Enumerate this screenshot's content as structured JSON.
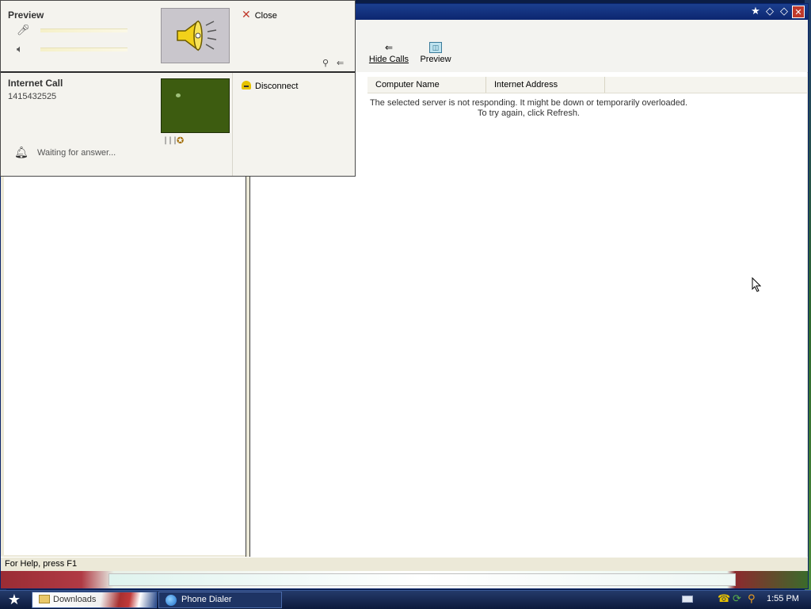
{
  "window": {
    "controls": [
      "★",
      "◇",
      "◇",
      "✕"
    ]
  },
  "toolbar": {
    "hide_calls": {
      "label": "Hide Calls",
      "icon": "arrow-left-icon"
    },
    "preview": {
      "label": "Preview",
      "icon": "preview-icon"
    }
  },
  "list": {
    "columns": [
      "Computer Name",
      "Internet Address"
    ],
    "message_line1": "The selected server is not responding. It might be down or temporarily overloaded.",
    "message_line2": "To try again, click Refresh."
  },
  "statusbar": {
    "text": "For Help, press F1"
  },
  "call_panel": {
    "preview": {
      "title": "Preview",
      "close_label": "Close",
      "mic_level": 0,
      "speaker_level": 0
    },
    "call": {
      "title": "Internet Call",
      "number": "1415432525",
      "status": "Waiting for answer...",
      "disconnect_label": "Disconnect"
    }
  },
  "taskbar": {
    "items": [
      {
        "label": "Downloads"
      },
      {
        "label": "Phone Dialer"
      }
    ],
    "clock": "1:55 PM"
  }
}
